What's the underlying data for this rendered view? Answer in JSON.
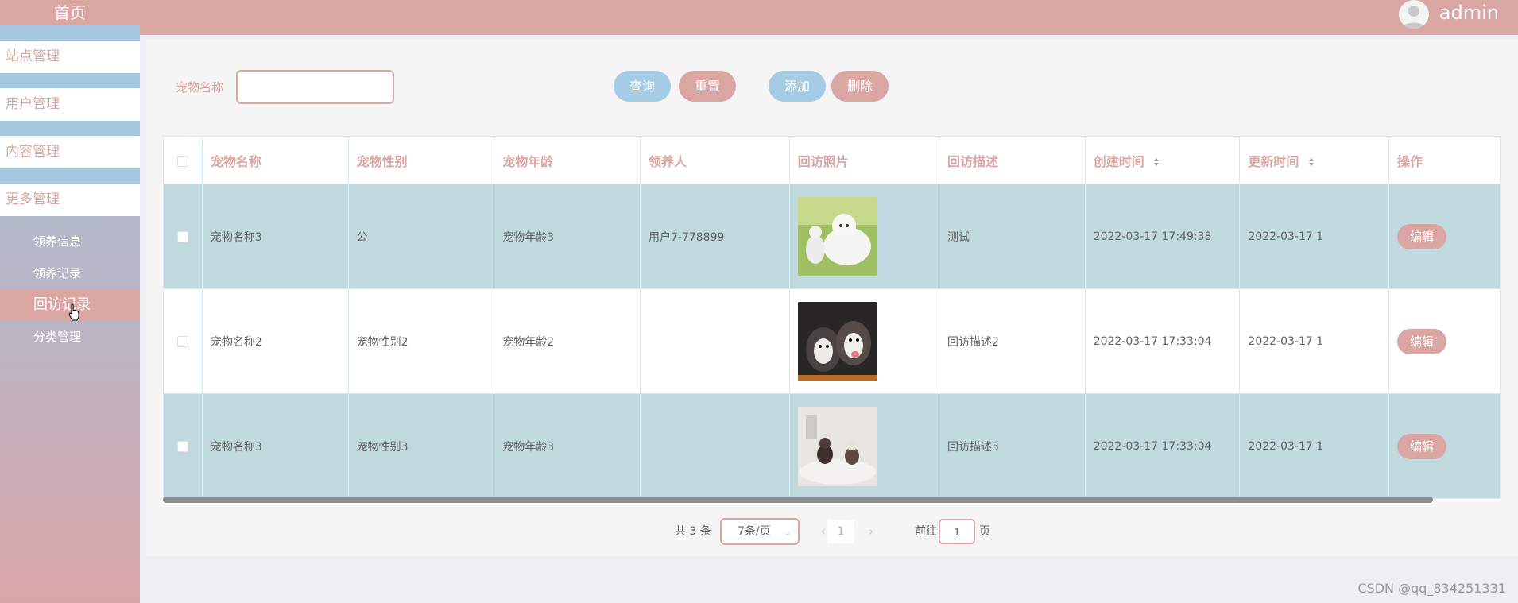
{
  "sidebar": {
    "home": "首页",
    "menus": [
      "站点管理",
      "用户管理",
      "内容管理",
      "更多管理"
    ],
    "sub_items": [
      "领养信息",
      "领养记录",
      "回访记录",
      "分类管理"
    ],
    "active_sub": "回访记录"
  },
  "topbar": {
    "username": "admin"
  },
  "search": {
    "label": "宠物名称",
    "value": "",
    "placeholder": ""
  },
  "toolbar": {
    "query": "查询",
    "reset": "重置",
    "add": "添加",
    "delete": "删除"
  },
  "table": {
    "headers": [
      "宠物名称",
      "宠物性别",
      "宠物年龄",
      "领养人",
      "回访照片",
      "回访描述",
      "创建时间",
      "更新时间",
      "操作"
    ],
    "rows": [
      {
        "name": "宠物名称3",
        "gender": "公",
        "age": "宠物年龄3",
        "adopter": "用户7-778899",
        "photo": "white-samoyed-dogs",
        "desc": "测试",
        "created": "2022-03-17 17:49:38",
        "updated": "2022-03-17 1",
        "action": "编辑"
      },
      {
        "name": "宠物名称2",
        "gender": "宠物性别2",
        "age": "宠物年龄2",
        "adopter": "",
        "photo": "husky-puppies",
        "desc": "回访描述2",
        "created": "2022-03-17 17:33:04",
        "updated": "2022-03-17 1",
        "action": "编辑"
      },
      {
        "name": "宠物名称3",
        "gender": "宠物性别3",
        "age": "宠物年龄3",
        "adopter": "",
        "photo": "small-dogs-on-rug",
        "desc": "回访描述3",
        "created": "2022-03-17 17:33:04",
        "updated": "2022-03-17 1",
        "action": "编辑"
      }
    ]
  },
  "pagination": {
    "total": "共 3 条",
    "page_size": "7条/页",
    "current_page": "1",
    "goto_label": "前往",
    "goto_value": "1",
    "page_suffix": "页"
  },
  "watermark": "CSDN @qq_834251331",
  "colors": {
    "primary": "#d9a6a3",
    "accent_blue": "#a6cbe4",
    "row_highlight": "#c0dae0"
  }
}
